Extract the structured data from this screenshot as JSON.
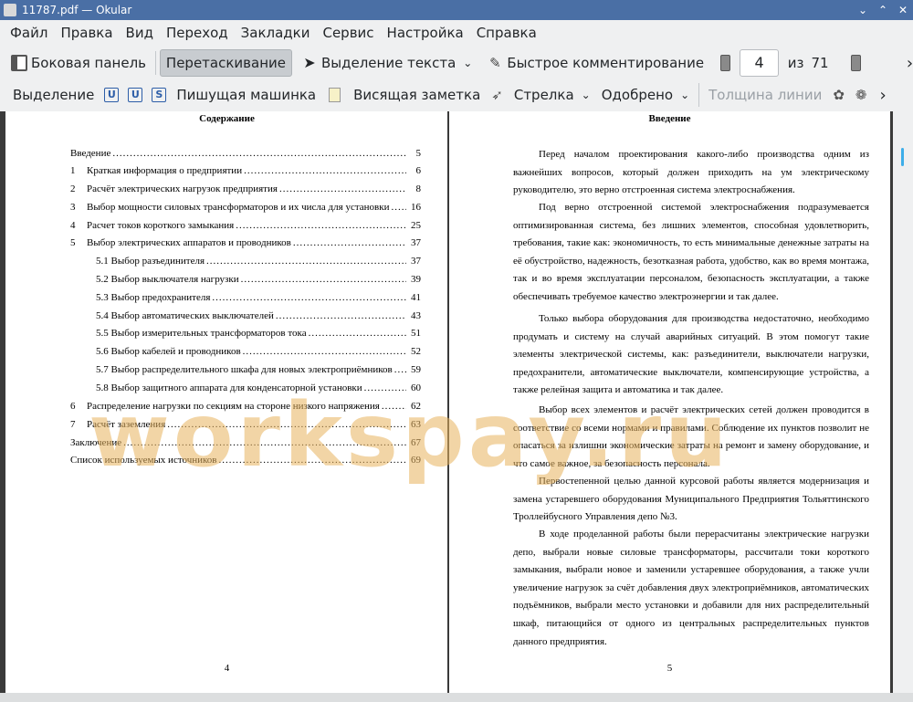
{
  "window": {
    "title": "11787.pdf — Okular",
    "controls": [
      "⌄",
      "⌃",
      "✕"
    ]
  },
  "menu": [
    "Файл",
    "Правка",
    "Вид",
    "Переход",
    "Закладки",
    "Сервис",
    "Настройка",
    "Справка"
  ],
  "toolbar": {
    "sidebar_label": "Боковая панель",
    "drag_label": "Перетаскивание",
    "select_text_label": "Выделение текста",
    "quick_comment_label": "Быстрое комментирование",
    "page_value": "4",
    "of_label": "из",
    "total_pages": "71",
    "more": "›"
  },
  "annot_toolbar": {
    "highlight_label": "Выделение",
    "typewriter_label": "Пишущая машинка",
    "note_label": "Висящая заметка",
    "arrow_label": "Стрелка",
    "stamp_label": "Одобрено",
    "line_width_label": "Толщина линии",
    "more": "›"
  },
  "left_page": {
    "title": "Содержание",
    "toc": [
      {
        "num": "",
        "text": "Введение",
        "page": "5"
      },
      {
        "num": "1",
        "text": "Краткая информация о предприятии",
        "page": "6"
      },
      {
        "num": "2",
        "text": "Расчёт электрических нагрузок предприятия",
        "page": "8"
      },
      {
        "num": "3",
        "text": "Выбор мощности силовых трансформаторов и их числа для установки",
        "page": "16"
      },
      {
        "num": "4",
        "text": "Расчет токов короткого замыкания",
        "page": "25"
      },
      {
        "num": "5",
        "text": "Выбор электрических аппаратов и проводников",
        "page": "37"
      },
      {
        "num": "",
        "text": "5.1 Выбор разъединителя",
        "page": "37"
      },
      {
        "num": "",
        "text": "5.2 Выбор выключателя нагрузки",
        "page": "39"
      },
      {
        "num": "",
        "text": "5.3 Выбор предохранителя",
        "page": "41"
      },
      {
        "num": "",
        "text": "5.4 Выбор автоматических выключателей",
        "page": "43"
      },
      {
        "num": "",
        "text": "5.5 Выбор измерительных трансформаторов тока",
        "page": "51"
      },
      {
        "num": "",
        "text": "5.6 Выбор кабелей и проводников",
        "page": "52"
      },
      {
        "num": "",
        "text": "5.7 Выбор распределительного шкафа для новых электроприёмников",
        "page": "59"
      },
      {
        "num": "",
        "text": "5.8 Выбор защитного аппарата для конденсаторной установки",
        "page": "60"
      },
      {
        "num": "6",
        "text": "Распределение нагрузки по секциям на стороне низкого напряжения",
        "page": "62"
      },
      {
        "num": "7",
        "text": "Расчёт заземления",
        "page": "63"
      },
      {
        "num": "",
        "text": "Заключение",
        "page": "67"
      },
      {
        "num": "",
        "text": "Список используемых источников",
        "page": "69"
      }
    ],
    "page_number": "4"
  },
  "right_page": {
    "title": "Введение",
    "paragraphs": [
      "Перед началом проектирования какого-либо производства одним из важнейших вопросов, который должен приходить на ум электрическому руководителю, это верно отстроенная система электроснабжения.",
      "Под верно отстроенной системой электроснабжения подразумевается оптимизированная система, без лишних элементов, способная удовлетворить, требования, такие как: экономичность, то есть минимальные денежные затраты на её обустройство, надежность, безотказная работа, удобство, как во время монтажа, так и во время эксплуатации персоналом, безопасность эксплуатации, а также обеспечивать требуемое качество электроэнергии и так далее.",
      "Только выбора оборудования для производства недостаточно, необходимо продумать и систему на случай аварийных ситуаций. В этом помогут такие элементы электрической системы, как: разъединители, выключатели нагрузки, предохранители, автоматические выключатели, компенсирующие устройства, а также релейная защита и автоматика и так далее.",
      "Выбор всех элементов и расчёт электрических сетей должен проводится в соответствие со всеми нормами и правилами. Соблюдение их пунктов позволит не опасаться за излишни экономические затраты на ремонт и замену оборудование, и что самое важное, за безопасность персонала.",
      "Первостепенной целью данной курсовой работы является модернизация и замена устаревшего оборудования Муниципального Предприятия Тольяттинского Троллейбусного Управления депо №3.",
      "В ходе проделанной работы были перерасчитаны электрические нагрузки депо, выбрали новые силовые трансформаторы, рассчитали токи короткого замыкания, выбрали новое и заменили устаревшее оборудования, а также учли увеличение нагрузок за счёт добавления двух электроприёмников, автоматических подъёмников, выбрали место установки и добавили для них распределительный шкаф, питающийся от одного из центральных распределительных пунктов данного предприятия."
    ],
    "page_number": "5"
  },
  "watermark": "workspay.ru"
}
